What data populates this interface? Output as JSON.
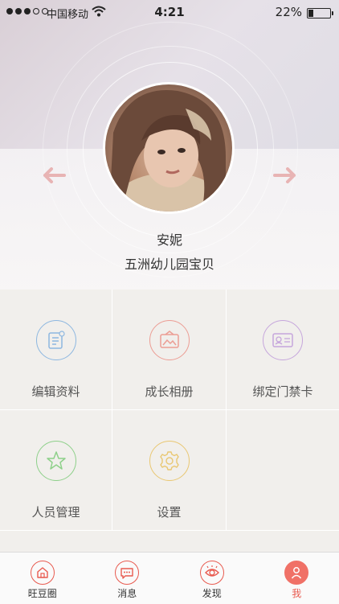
{
  "status_bar": {
    "carrier": "中国移动",
    "time": "4:21",
    "battery_percent": "22%",
    "battery_level": 0.22,
    "signal_bars_filled": 3,
    "signal_bars_total": 5
  },
  "profile": {
    "name": "安妮",
    "subtitle": "五洲幼儿园宝贝",
    "prev_icon": "arrow-left-icon",
    "next_icon": "arrow-right-icon"
  },
  "menu": [
    {
      "label": "编辑资料",
      "icon": "edit-profile-icon",
      "color": "#8db7e0"
    },
    {
      "label": "成长相册",
      "icon": "photo-album-icon",
      "color": "#ec9d94"
    },
    {
      "label": "绑定门禁卡",
      "icon": "id-card-icon",
      "color": "#c6a6dc"
    },
    {
      "label": "人员管理",
      "icon": "star-icon",
      "color": "#8ed08a"
    },
    {
      "label": "设置",
      "icon": "gear-icon",
      "color": "#e9c772"
    }
  ],
  "tabs": [
    {
      "label": "旺豆圈",
      "icon": "home-icon",
      "active": false
    },
    {
      "label": "消息",
      "icon": "message-icon",
      "active": false
    },
    {
      "label": "发现",
      "icon": "eye-icon",
      "active": false
    },
    {
      "label": "我",
      "icon": "person-icon",
      "active": true
    }
  ],
  "colors": {
    "accent": "#e85a4f",
    "active_tab_bg": "#f07167",
    "arrow": "#e8b4b4"
  }
}
